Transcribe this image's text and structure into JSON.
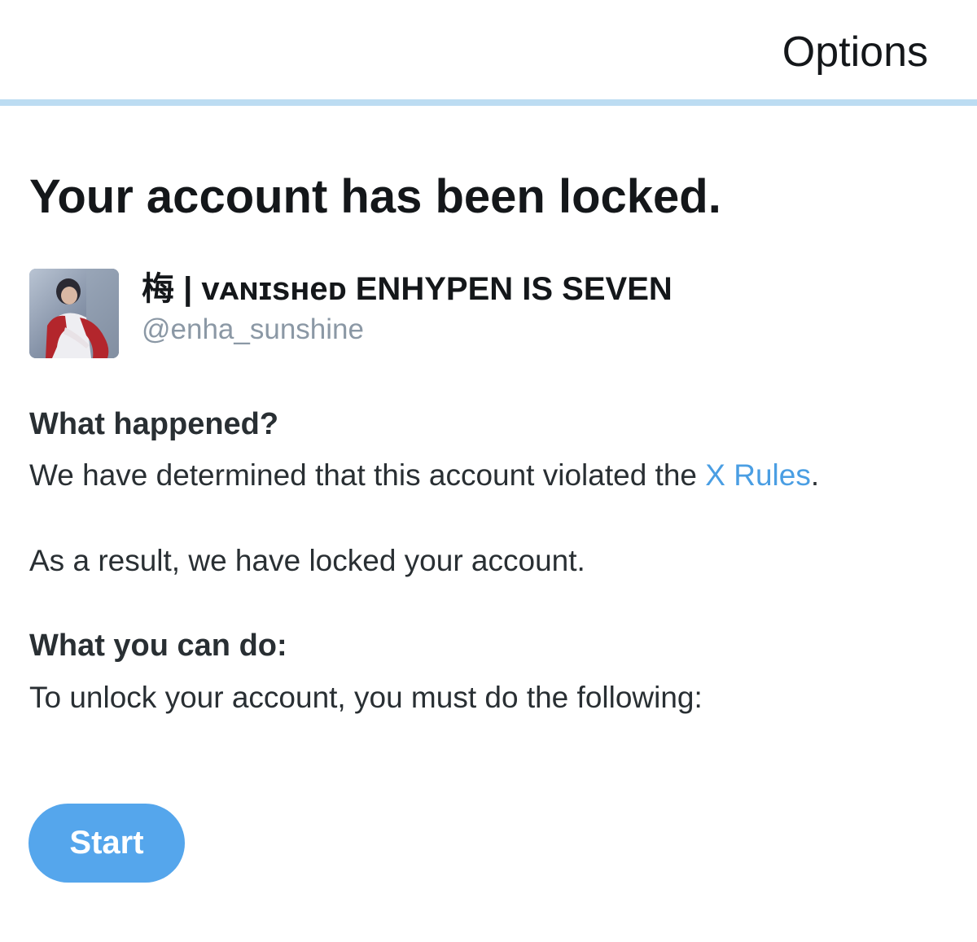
{
  "header": {
    "options_label": "Options",
    "rule_color": "#bcdcf2"
  },
  "page": {
    "title": "Your account has been locked."
  },
  "account": {
    "display_name": "梅 | ᴠᴀɴɪsʜeᴅ ENHYPEN IS SEVEN",
    "handle": "@enha_sunshine",
    "avatar_icon": "profile-photo"
  },
  "what_happened": {
    "heading": "What happened?",
    "text_before_link": "We have determined that this account violated the ",
    "link_label": "X Rules",
    "text_after_link": ".",
    "result_text": "As a result, we have locked your account."
  },
  "what_you_can_do": {
    "heading": "What you can do:",
    "text": "To unlock your account, you must do the following:"
  },
  "actions": {
    "start_label": "Start"
  },
  "colors": {
    "link": "#4a9ee3",
    "button": "#55a6ec",
    "handle": "#8b98a5",
    "text": "#14171a"
  }
}
